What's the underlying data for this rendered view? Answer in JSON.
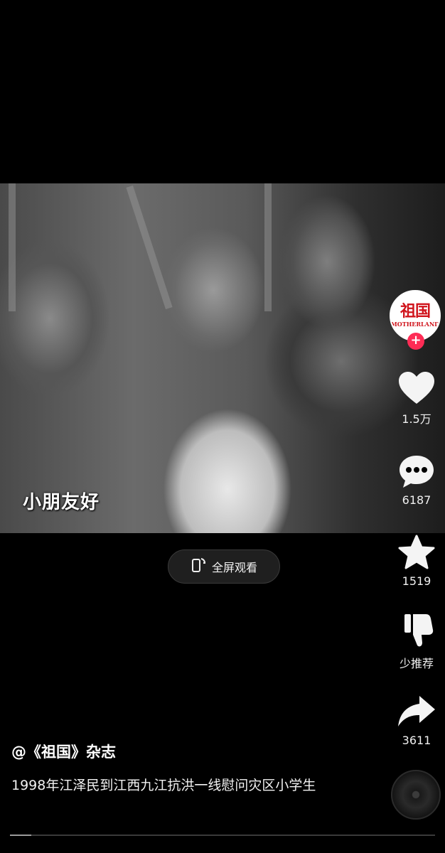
{
  "video": {
    "caption": "小朋友好",
    "fullscreen_label": "全屏观看"
  },
  "account": {
    "avatar_logo_cn": "祖国",
    "avatar_logo_en": "MOTHERLAND",
    "author": "@《祖国》杂志"
  },
  "actions": {
    "like_count": "1.5万",
    "comment_count": "6187",
    "favorite_count": "1519",
    "not_interested_label": "少推荐",
    "share_count": "3611"
  },
  "description": "1998年江泽民到江西九江抗洪一线慰问灾区小学生",
  "colors": {
    "background": "#000000",
    "follow_plus": "#fe2c55",
    "logo_red": "#d0141c"
  },
  "icons": [
    "phone-rotate-icon",
    "heart-icon",
    "comment-icon",
    "star-icon",
    "thumbs-down-icon",
    "share-arrow-icon",
    "music-disc-icon",
    "plus-icon"
  ],
  "progress": 0.05
}
